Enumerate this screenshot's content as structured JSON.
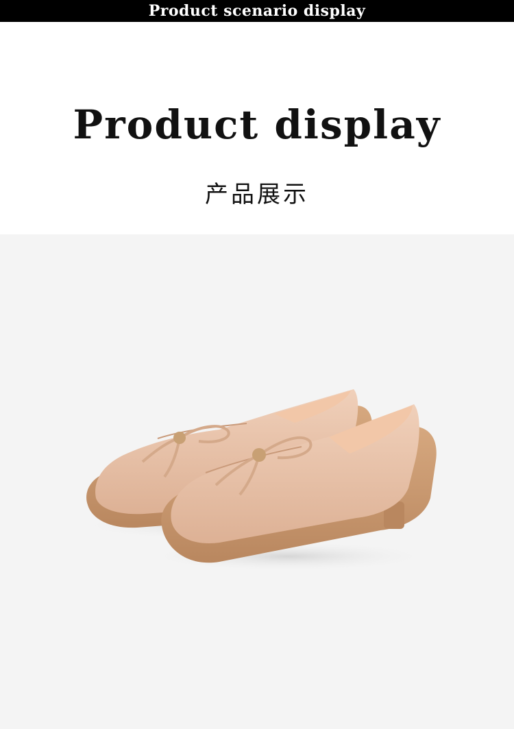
{
  "banner": {
    "text": "Product scenario display"
  },
  "section": {
    "title": "Product display",
    "subtitle": "产品展示"
  },
  "product_image": {
    "subject": "shoes-icon",
    "colors": {
      "background": "#f4f4f4",
      "upper": "#e8c2a8",
      "upper_shade": "#d9ab8d",
      "sole": "#c99a72",
      "lining": "#f2c7a8",
      "bow_button": "#c8a074"
    }
  }
}
